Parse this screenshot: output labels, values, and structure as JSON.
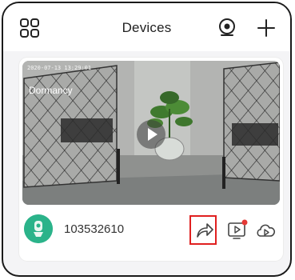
{
  "header": {
    "title": "Devices",
    "left_icon": "grid-menu-icon",
    "right_icons": [
      "camera-lens-icon",
      "plus-icon"
    ]
  },
  "device": {
    "timestamp": "2020-07-13 13:29:01",
    "mode": "Dormancy",
    "id": "103532610",
    "actions": [
      "share-icon",
      "playback-icon",
      "cloud-play-icon"
    ],
    "playback_badge_color": "#e53935",
    "highlight_color": "#e02020",
    "avatar_color": "#2bb38a"
  }
}
